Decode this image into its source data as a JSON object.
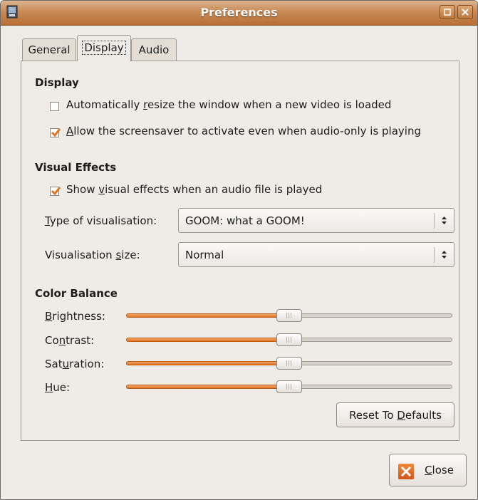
{
  "window": {
    "title": "Preferences"
  },
  "tabs": [
    {
      "label": "General",
      "active": false
    },
    {
      "label": "Display",
      "active": true
    },
    {
      "label": "Audio",
      "active": false
    }
  ],
  "display": {
    "heading": "Display",
    "auto_resize": {
      "label_pre": "Automatically ",
      "label_u": "r",
      "label_post": "esize the window when a new video is loaded",
      "checked": false
    },
    "screensaver": {
      "label_pre": "",
      "label_u": "A",
      "label_post": "llow the screensaver to activate even when audio-only is playing",
      "checked": true
    }
  },
  "visual_effects": {
    "heading": "Visual Effects",
    "show_effects": {
      "label_pre": "Show ",
      "label_u": "v",
      "label_post": "isual effects when an audio file is played",
      "checked": true
    },
    "type": {
      "label_pre": "",
      "label_u": "T",
      "label_post": "ype of visualisation:",
      "value": "GOOM: what a GOOM!"
    },
    "size": {
      "label_pre": "Visualisation ",
      "label_u": "s",
      "label_post": "ize:",
      "value": "Normal"
    }
  },
  "color_balance": {
    "heading": "Color Balance",
    "sliders": [
      {
        "label_pre": "",
        "label_u": "B",
        "label_post": "rightness:",
        "value_fraction": 0.5
      },
      {
        "label_pre": "Co",
        "label_u": "n",
        "label_post": "trast:",
        "value_fraction": 0.5
      },
      {
        "label_pre": "Sat",
        "label_u": "u",
        "label_post": "ration:",
        "value_fraction": 0.5
      },
      {
        "label_pre": "",
        "label_u": "H",
        "label_post": "ue:",
        "value_fraction": 0.5
      }
    ],
    "reset": {
      "label_pre": "Reset To ",
      "label_u": "D",
      "label_post": "efaults"
    }
  },
  "close_button": {
    "label_pre": "",
    "label_u": "C",
    "label_post": "lose"
  },
  "colors": {
    "accent": "#e2741f",
    "titlebar": "#c88a55",
    "background": "#efebe7"
  }
}
